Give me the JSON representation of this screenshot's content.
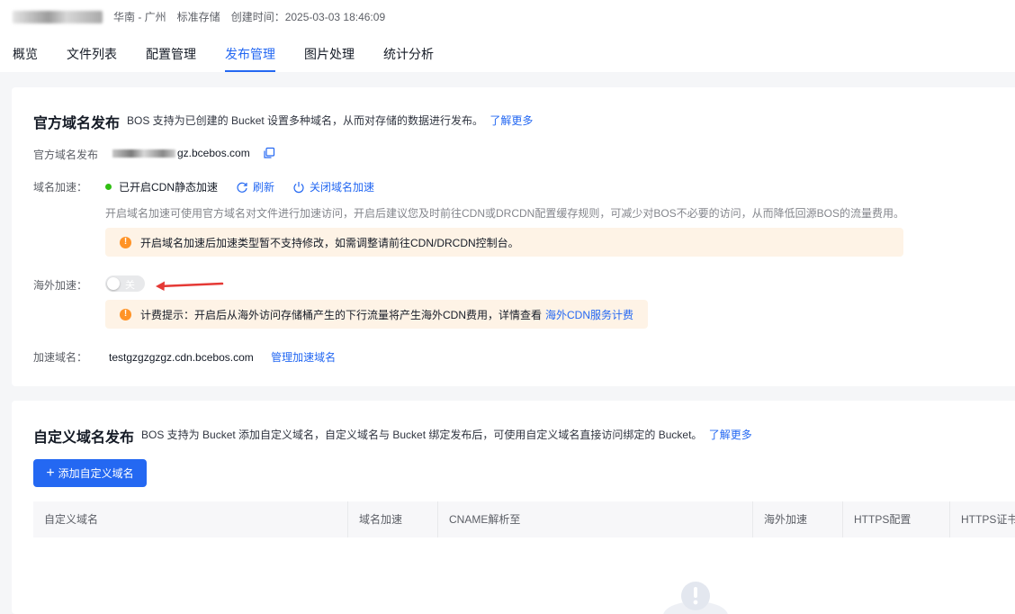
{
  "header": {
    "bucket_name_blurred": "testgzgzgzgz",
    "region": "华南 - 广州",
    "storage_class": "标准存储",
    "created": "创建时间：2025-03-03 18:46:09"
  },
  "tabs": [
    "概览",
    "文件列表",
    "配置管理",
    "发布管理",
    "图片处理",
    "统计分析"
  ],
  "active_tab": "发布管理",
  "official": {
    "title": "官方域名发布",
    "desc": "BOS 支持为已创建的 Bucket 设置多种域名，从而对存储的数据进行发布。",
    "learn_more": "了解更多",
    "domain_label": "官方域名发布",
    "domain_suffix": "gz.bcebos.com",
    "accel_label": "域名加速：",
    "accel_status": "已开启CDN静态加速",
    "refresh": "刷新",
    "close_accel": "关闭域名加速",
    "accel_help": "开启域名加速可使用官方域名对文件进行加速访问，开启后建议您及时前往CDN或DRCDN配置缓存规则，可减少对BOS不必要的访问，从而降低回源BOS的流量费用。",
    "accel_alert": "开启域名加速后加速类型暂不支持修改，如需调整请前往CDN/DRCDN控制台。",
    "overseas_label": "海外加速：",
    "overseas_switch": "关",
    "overseas_alert": "计费提示：开启后从海外访问存储桶产生的下行流量将产生海外CDN费用，详情查看",
    "overseas_link": "海外CDN服务计费",
    "cdn_label": "加速域名：",
    "cdn_domain": "testgzgzgzgz.cdn.bcebos.com",
    "manage_link": "管理加速域名"
  },
  "custom": {
    "title": "自定义域名发布",
    "desc": "BOS 支持为 Bucket 添加自定义域名，自定义域名与 Bucket 绑定发布后，可使用自定义域名直接访问绑定的 Bucket。",
    "learn_more": "了解更多",
    "add_button": "添加自定义域名",
    "columns": [
      "自定义域名",
      "域名加速",
      "CNAME解析至",
      "海外加速",
      "HTTPS配置",
      "HTTPS证书"
    ]
  },
  "colors": {
    "primary": "#2468f2",
    "success": "#30bf13",
    "warning": "#ff9326",
    "annotation_arrow": "#e53935"
  },
  "icons": [
    "copy-icon",
    "refresh-icon",
    "power-icon",
    "warning-icon",
    "plus-icon",
    "empty-cloud-icon"
  ]
}
